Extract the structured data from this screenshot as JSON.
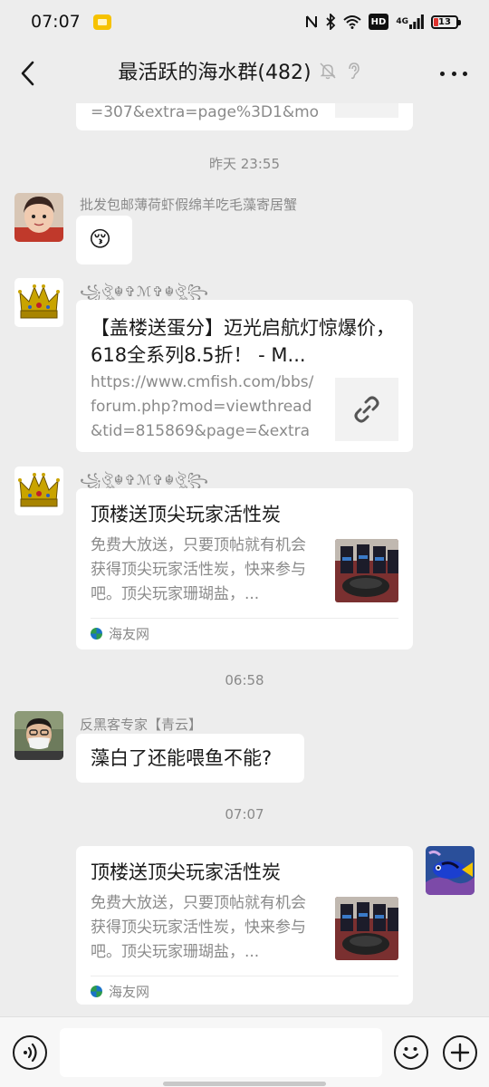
{
  "status": {
    "time": "07:07",
    "network": "4G",
    "hd_label": "HD",
    "battery": "13"
  },
  "nav": {
    "title": "最活跃的海水群(482)"
  },
  "messages": {
    "top_partial_desc": "=307&extra=page%3D1&mo...",
    "ts1": "昨天 23:55",
    "m1_sender": "批发包邮薄荷虾假绵羊吃毛藻寄居蟹",
    "m1_text": "😚",
    "m2_sender": "꧁ঔৣ☬✞ℳ✞☬ঔৣ꧂",
    "m2_title": "【盖楼送蛋分】迈光启航灯惊爆价，618全系列8.5折！ - M...",
    "m2_desc": "https://www.cmfish.com/bbs/forum.php?mod=viewthread&tid=815869&page=&extra=...",
    "m3_sender": "꧁ঔৣ☬✞ℳ✞☬ঔৣ꧂",
    "m3_title": "顶楼送顶尖玩家活性炭",
    "m3_desc": "免费大放送，只要顶帖就有机会获得顶尖玩家活性炭，快来参与吧。顶尖玩家珊瑚盐，...",
    "m3_source": "海友网",
    "ts2": "06:58",
    "m4_sender": "反黑客专家【青云】",
    "m4_text": "藻白了还能喂鱼不能?",
    "ts3": "07:07",
    "m5_title": "顶楼送顶尖玩家活性炭",
    "m5_desc": "免费大放送，只要顶帖就有机会获得顶尖玩家活性炭，快来参与吧。顶尖玩家珊瑚盐，...",
    "m5_source": "海友网"
  },
  "input": {
    "value": "",
    "placeholder": ""
  }
}
